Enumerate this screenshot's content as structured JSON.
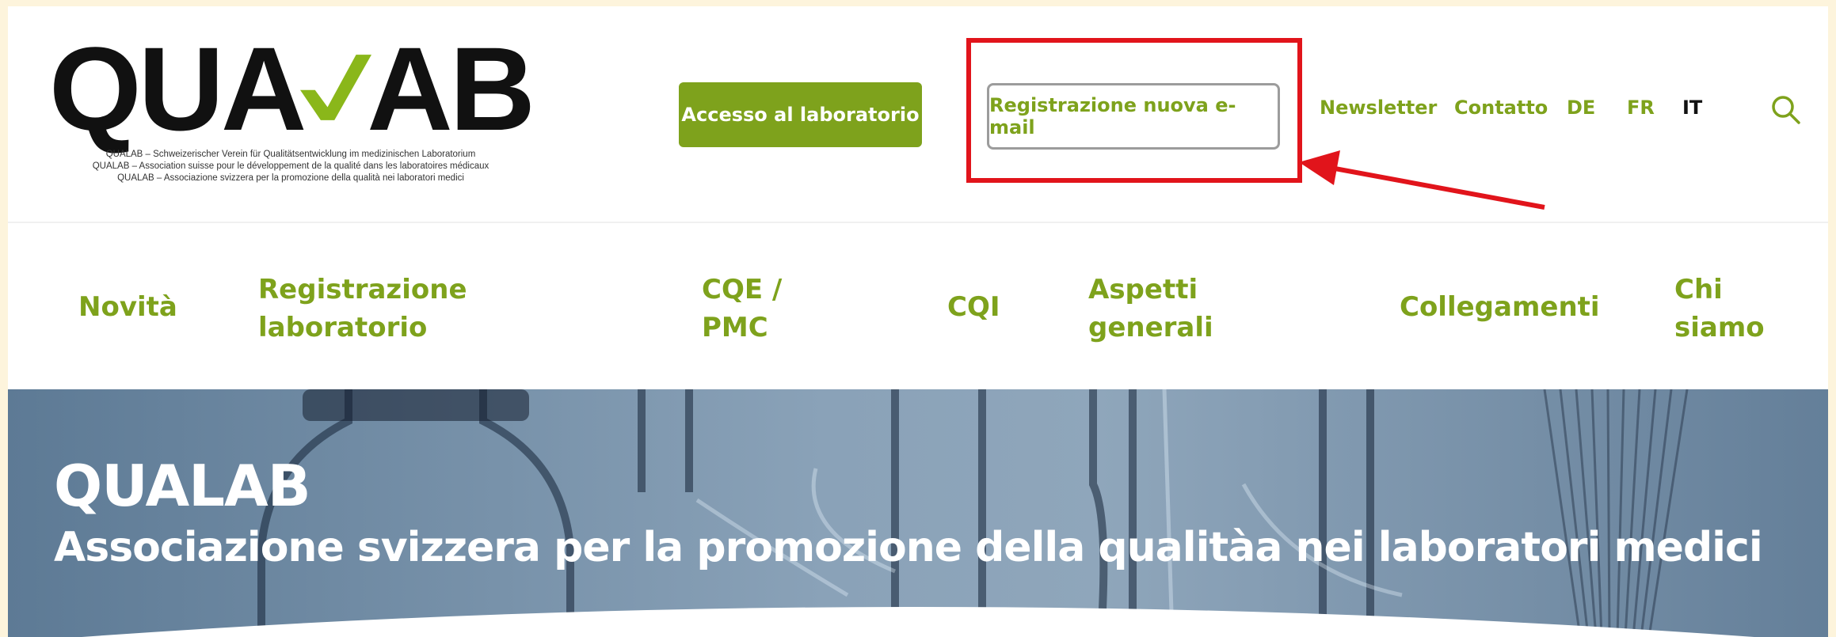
{
  "logo": {
    "left_text": "QUA",
    "right_text": "AB",
    "tagline_de": "QUALAB – Schweizerischer Verein für Qualitätsentwicklung im medizinischen Laboratorium",
    "tagline_fr": "QUALAB – Association suisse pour le développement de la qualité dans les laboratoires médicaux",
    "tagline_it": "QUALAB – Associazione svizzera per la promozione della qualità nei laboratori medici"
  },
  "header": {
    "access_button": "Accesso al laboratorio",
    "register_button": "Registrazione nuova e-mail",
    "links": {
      "newsletter": "Newsletter",
      "contact": "Contatto",
      "de": "DE",
      "fr": "FR",
      "it": "IT"
    }
  },
  "nav": {
    "novita": "Novità",
    "registrazione_1": "Registrazione",
    "registrazione_2": "laboratorio",
    "cqe_1": "CQE /",
    "cqe_2": "PMC",
    "cqi": "CQI",
    "aspetti_1": "Aspetti",
    "aspetti_2": "generali",
    "collegamenti": "Collegamenti",
    "chi_1": "Chi",
    "chi_2": "siamo"
  },
  "hero": {
    "title": "QUALAB",
    "subtitle": "Associazione svizzera per la promozione della qualitàa nei laboratori medici"
  },
  "colors": {
    "accent_green": "#7ea21c",
    "highlight_red": "#e1141b",
    "background_cream": "#fdf4dc"
  },
  "icons": {
    "search": "search-icon",
    "check": "check-logo-icon",
    "arrow": "annotation-arrow-icon"
  }
}
